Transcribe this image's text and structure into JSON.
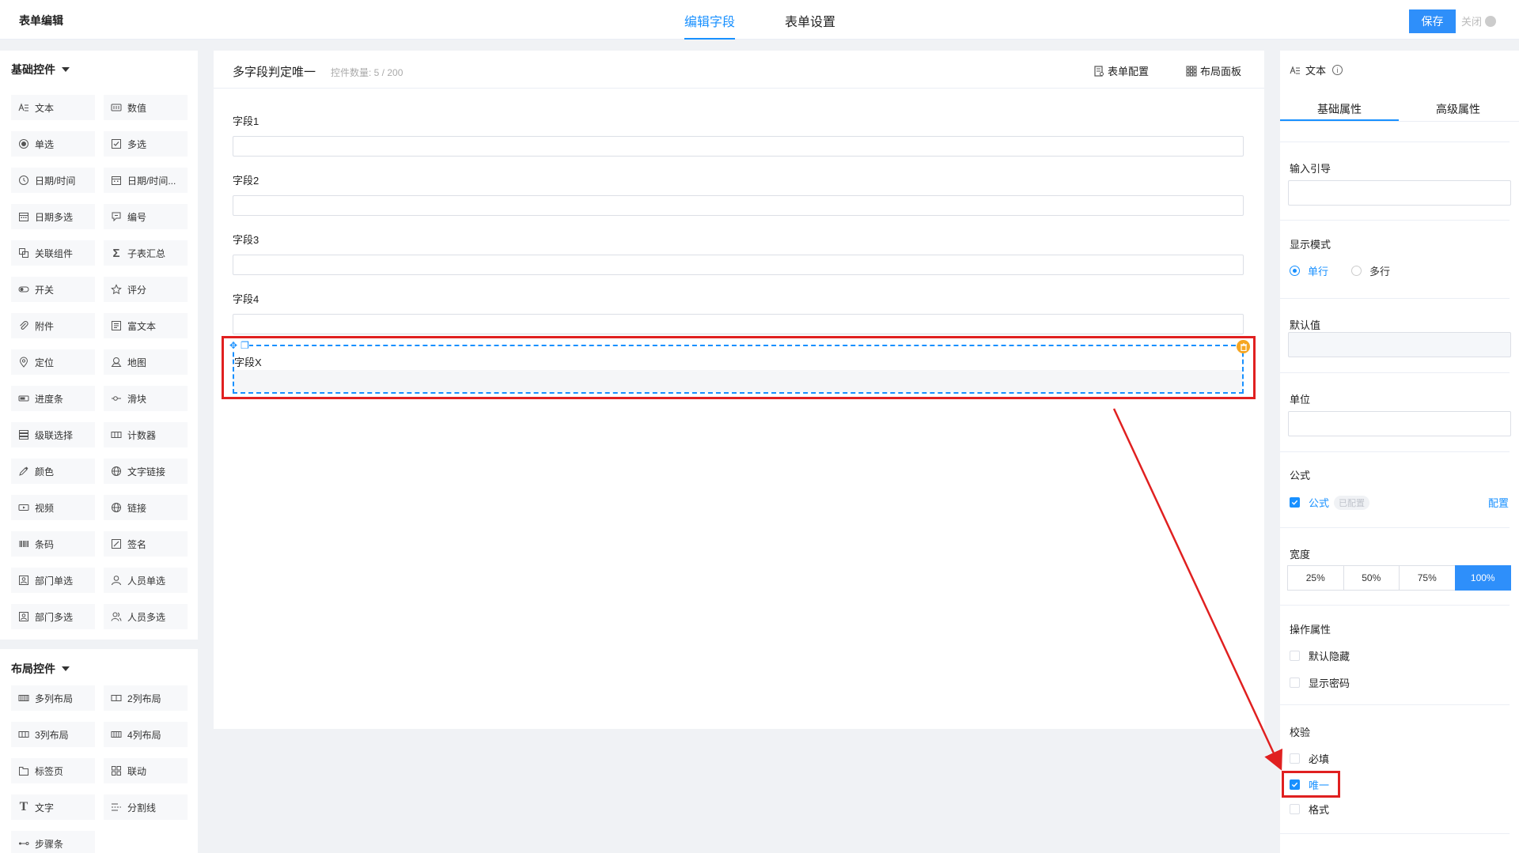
{
  "app": {
    "title": "表单编辑",
    "save": "保存",
    "close": "关闭"
  },
  "tabs": [
    {
      "label": "编辑字段",
      "active": true
    },
    {
      "label": "表单设置",
      "active": false
    }
  ],
  "palette": {
    "basic_title": "基础控件",
    "basic": [
      {
        "label": "文本",
        "icon": "text-icon"
      },
      {
        "label": "数值",
        "icon": "number-icon"
      },
      {
        "label": "单选",
        "icon": "radio-icon"
      },
      {
        "label": "多选",
        "icon": "checkbox-icon"
      },
      {
        "label": "日期/时间",
        "icon": "clock-icon"
      },
      {
        "label": "日期/时间...",
        "icon": "calendar-icon"
      },
      {
        "label": "日期多选",
        "icon": "calendar-multi-icon"
      },
      {
        "label": "编号",
        "icon": "serial-icon"
      },
      {
        "label": "关联组件",
        "icon": "link-component-icon"
      },
      {
        "label": "子表汇总",
        "icon": "sigma-icon"
      },
      {
        "label": "开关",
        "icon": "toggle-icon"
      },
      {
        "label": "评分",
        "icon": "star-icon"
      },
      {
        "label": "附件",
        "icon": "paperclip-icon"
      },
      {
        "label": "富文本",
        "icon": "richtext-icon"
      },
      {
        "label": "定位",
        "icon": "location-icon"
      },
      {
        "label": "地图",
        "icon": "map-icon"
      },
      {
        "label": "进度条",
        "icon": "progress-icon"
      },
      {
        "label": "滑块",
        "icon": "slider-icon"
      },
      {
        "label": "级联选择",
        "icon": "cascade-icon"
      },
      {
        "label": "计数器",
        "icon": "counter-icon"
      },
      {
        "label": "颜色",
        "icon": "color-picker-icon"
      },
      {
        "label": "文字链接",
        "icon": "globe-icon"
      },
      {
        "label": "视频",
        "icon": "video-icon"
      },
      {
        "label": "链接",
        "icon": "globe-icon"
      },
      {
        "label": "条码",
        "icon": "barcode-icon"
      },
      {
        "label": "签名",
        "icon": "signature-icon"
      },
      {
        "label": "部门单选",
        "icon": "department-icon"
      },
      {
        "label": "人员单选",
        "icon": "user-icon"
      },
      {
        "label": "部门多选",
        "icon": "department-multi-icon"
      },
      {
        "label": "人员多选",
        "icon": "users-icon"
      }
    ],
    "layout_title": "布局控件",
    "layout": [
      {
        "label": "多列布局",
        "icon": "multi-column-icon"
      },
      {
        "label": "2列布局",
        "icon": "two-column-icon"
      },
      {
        "label": "3列布局",
        "icon": "three-column-icon"
      },
      {
        "label": "4列布局",
        "icon": "four-column-icon"
      },
      {
        "label": "标签页",
        "icon": "tabs-icon"
      },
      {
        "label": "联动",
        "icon": "linkage-icon"
      },
      {
        "label": "文字",
        "icon": "text-t-icon"
      },
      {
        "label": "分割线",
        "icon": "divider-icon"
      },
      {
        "label": "步骤条",
        "icon": "steps-icon"
      }
    ]
  },
  "canvas": {
    "form_name": "多字段判定唯一",
    "count_label": "控件数量: 5 / 200",
    "form_config": "表单配置",
    "layout_panel": "布局面板",
    "fields": [
      {
        "label": "字段1"
      },
      {
        "label": "字段2"
      },
      {
        "label": "字段3"
      },
      {
        "label": "字段4"
      }
    ],
    "selected_field": {
      "label": "字段X"
    }
  },
  "props": {
    "title": "文本",
    "tabs": [
      "基础属性",
      "高级属性"
    ],
    "input_hint": "输入引导",
    "display_mode": "显示模式",
    "mode_single": "单行",
    "mode_multi": "多行",
    "default_value": "默认值",
    "unit": "单位",
    "formula_title": "公式",
    "formula_check": "公式",
    "formula_tag": "已配置",
    "formula_config": "配置",
    "width_title": "宽度",
    "widths": [
      "25%",
      "50%",
      "75%",
      "100%"
    ],
    "width_selected": "100%",
    "operation": "操作属性",
    "default_hidden": "默认隐藏",
    "show_password": "显示密码",
    "validation": "校验",
    "required": "必填",
    "unique": "唯一",
    "format": "格式"
  },
  "colors": {
    "accent": "#1890ff",
    "annotation": "#e02020",
    "delete": "#f5a623"
  }
}
